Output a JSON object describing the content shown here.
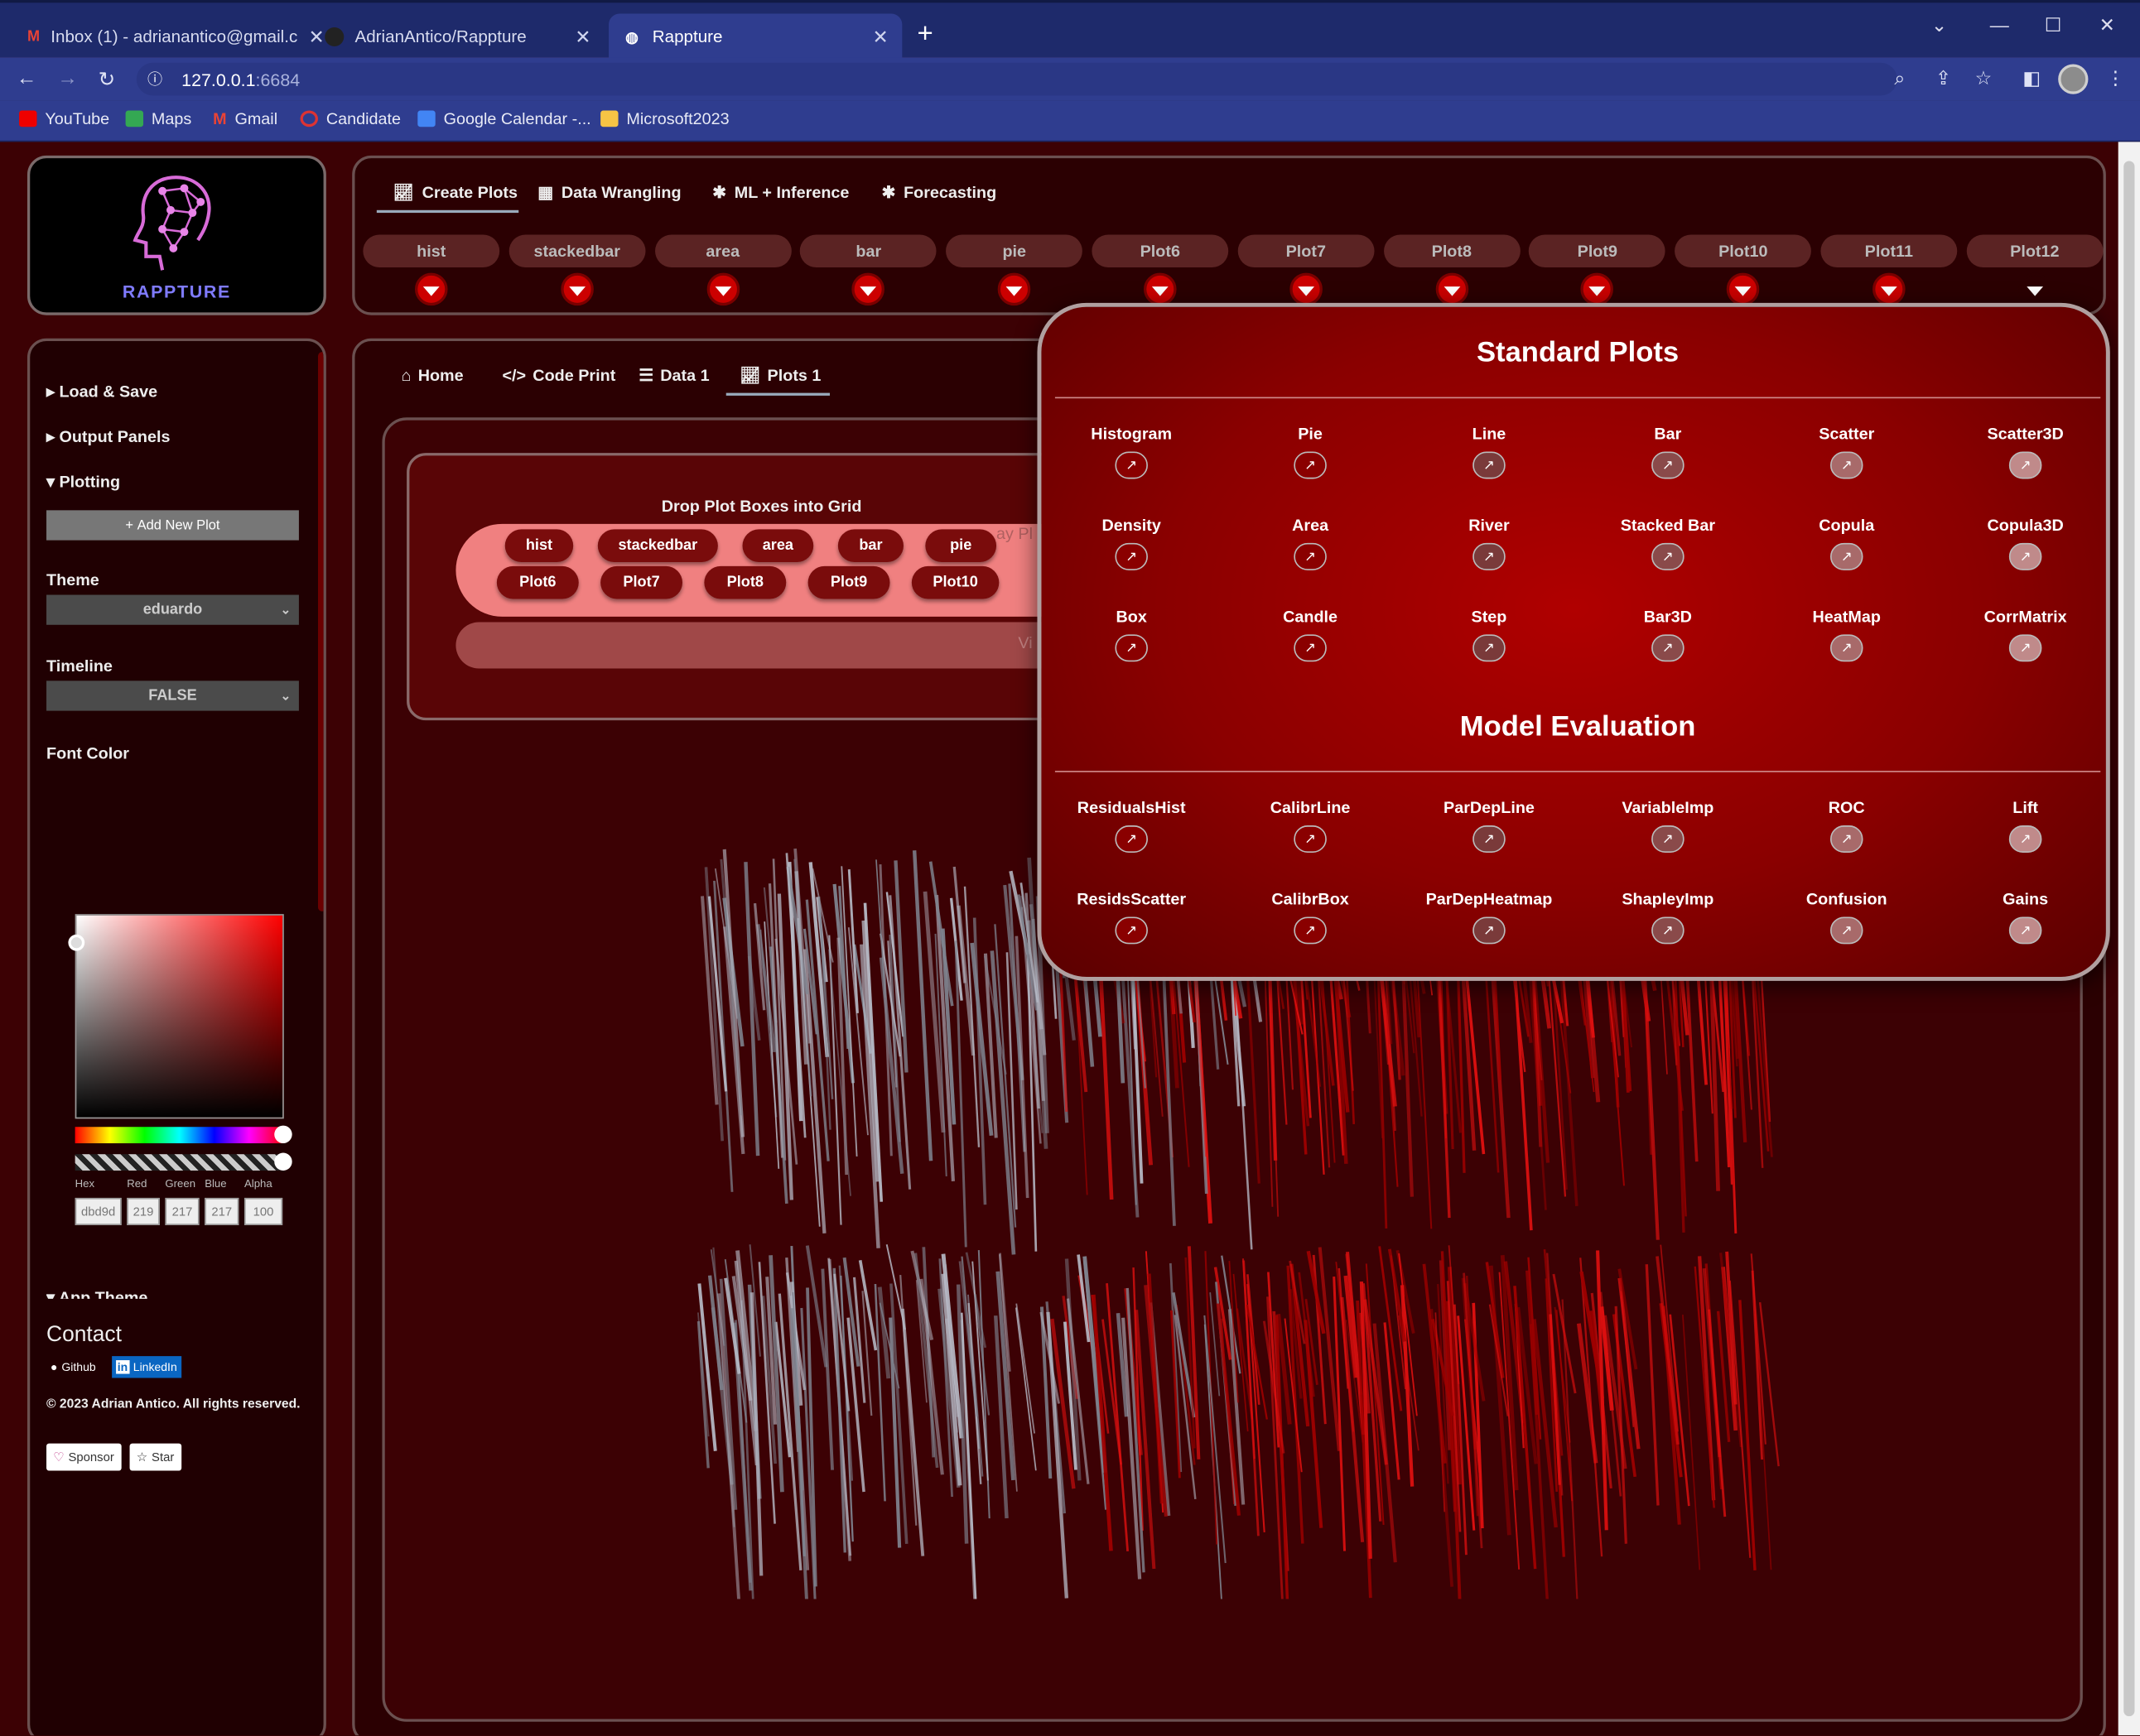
{
  "browser": {
    "tabs": [
      {
        "title": "Inbox (1) - adrianantico@gmail.c",
        "icon": "gmail-icon"
      },
      {
        "title": "AdrianAntico/Rappture",
        "icon": "github-icon"
      },
      {
        "title": "Rappture",
        "icon": "globe-icon"
      }
    ],
    "url_host": "127.0.0.1",
    "url_port": ":6684",
    "bookmarks": [
      "YouTube",
      "Maps",
      "Gmail",
      "Candidate",
      "Google Calendar -...",
      "Microsoft2023"
    ]
  },
  "logo": {
    "text": "RAPPTURE"
  },
  "main_tabs": [
    "Create Plots",
    "Data Wrangling",
    "ML + Inference",
    "Forecasting"
  ],
  "plot_slots": [
    "hist",
    "stackedbar",
    "area",
    "bar",
    "pie",
    "Plot6",
    "Plot7",
    "Plot8",
    "Plot9",
    "Plot10",
    "Plot11",
    "Plot12"
  ],
  "sidebar": {
    "sections": [
      "Load & Save",
      "Output Panels",
      "Plotting"
    ],
    "add_plot": "Add New Plot",
    "theme_label": "Theme",
    "theme_value": "eduardo",
    "timeline_label": "Timeline",
    "timeline_value": "FALSE",
    "font_color_label": "Font Color",
    "color_fields": [
      "Hex",
      "Red",
      "Green",
      "Blue",
      "Alpha"
    ],
    "color_values": [
      "dbd9d",
      "219",
      "217",
      "217",
      "100"
    ],
    "app_theme": "App Theme",
    "contact": "Contact",
    "github": "Github",
    "linkedin": "LinkedIn",
    "copyright": "© 2023 Adrian Antico. All rights reserved.",
    "sponsor": "Sponsor",
    "star": "Star"
  },
  "sub_tabs": [
    "Home",
    "Code Print",
    "Data 1",
    "Plots 1"
  ],
  "dropzone": {
    "title": "Drop Plot Boxes into Grid",
    "hint": "ay Pl",
    "hint2": "Vi",
    "row1": [
      "hist",
      "stackedbar",
      "area",
      "bar",
      "pie"
    ],
    "row2": [
      "Plot6",
      "Plot7",
      "Plot8",
      "Plot9",
      "Plot10"
    ]
  },
  "panel": {
    "standard_title": "Standard Plots",
    "standard": [
      "Histogram",
      "Pie",
      "Line",
      "Bar",
      "Scatter",
      "Scatter3D",
      "Density",
      "Area",
      "River",
      "Stacked Bar",
      "Copula",
      "Copula3D",
      "Box",
      "Candle",
      "Step",
      "Bar3D",
      "HeatMap",
      "CorrMatrix"
    ],
    "model_title": "Model Evaluation",
    "model": [
      "ResidualsHist",
      "CalibrLine",
      "ParDepLine",
      "VariableImp",
      "ROC",
      "Lift",
      "ResidsScatter",
      "CalibrBox",
      "ParDepHeatmap",
      "ShapleyImp",
      "Confusion",
      "Gains"
    ]
  },
  "colors": {
    "accent": "#cc0000",
    "background": "#3c0104",
    "panel": "#8a0000"
  }
}
